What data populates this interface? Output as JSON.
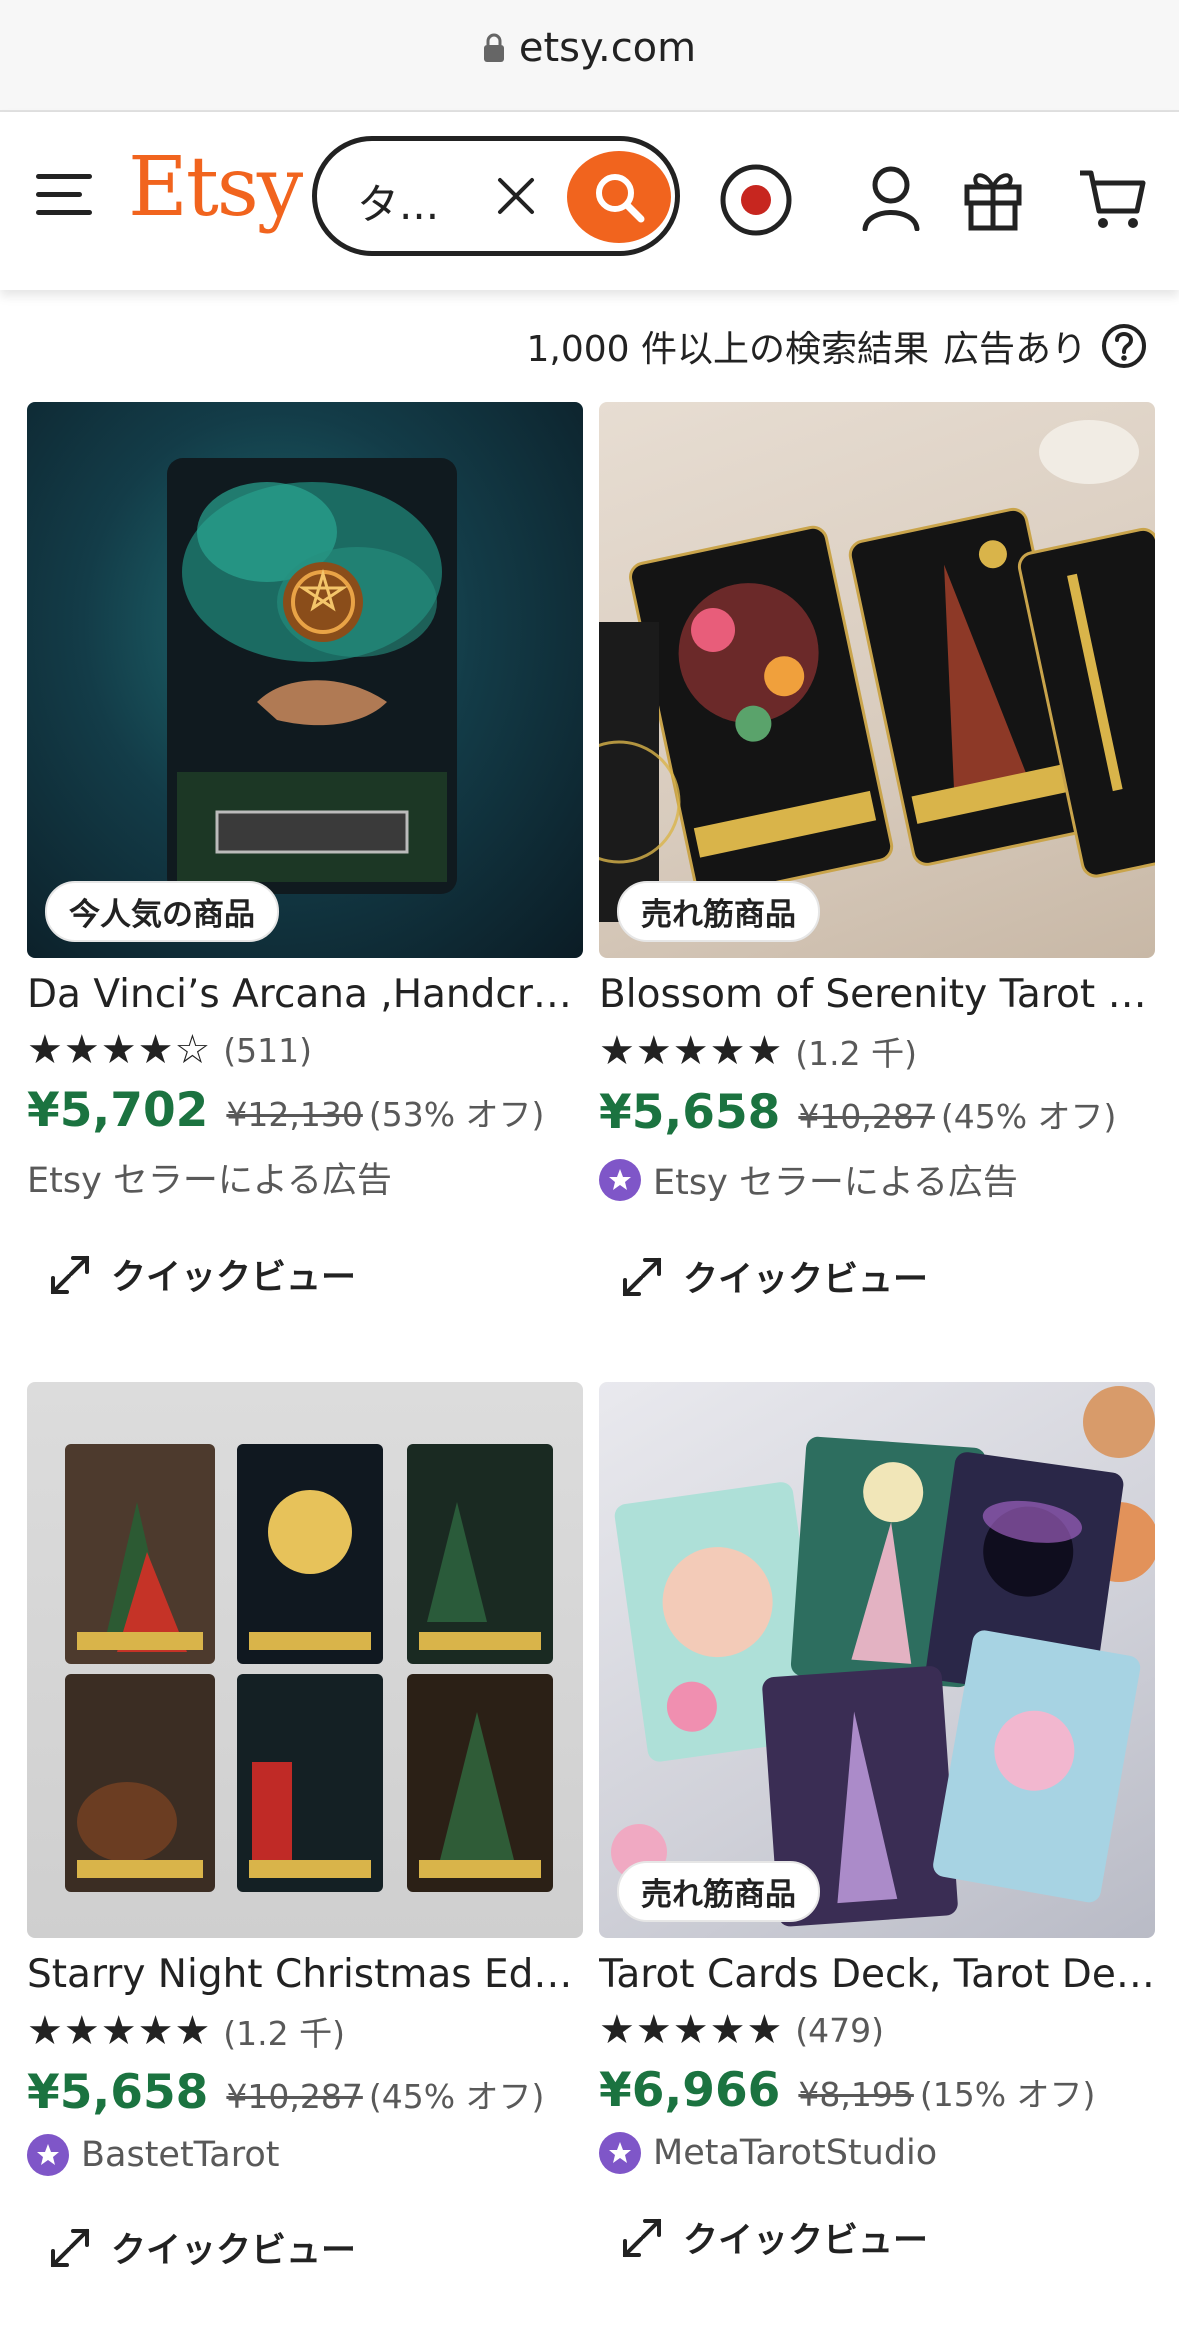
{
  "browser": {
    "url": "etsy.com"
  },
  "header": {
    "logo": "Etsy",
    "search_value": "タ...",
    "icons": [
      "menu-icon",
      "clear-icon",
      "search-icon",
      "record-icon",
      "account-icon",
      "gift-icon",
      "cart-icon"
    ]
  },
  "results": {
    "count_text": "1,000 件以上の検索結果",
    "ads_text": "広告あり"
  },
  "products": [
    {
      "badge": "今人気の商品",
      "title": "Da Vinci’s Arcana ,Handcrafted Tarot Deck",
      "stars": "★★★★☆",
      "rating_value": 4.5,
      "review_count": "(511)",
      "price": "¥5,702",
      "original_price": "¥12,130",
      "discount": "(53% オフ)",
      "seller": "Etsy セラーによる広告",
      "star_seller": false,
      "quick_view": "クイックビュー"
    },
    {
      "badge": "売れ筋商品",
      "title": "Blossom of Serenity Tarot Deck",
      "stars": "★★★★★",
      "rating_value": 5,
      "review_count": "(1.2 千)",
      "price": "¥5,658",
      "original_price": "¥10,287",
      "discount": "(45% オフ)",
      "seller": "Etsy セラーによる広告",
      "star_seller": true,
      "quick_view": "クイックビュー"
    },
    {
      "badge": "",
      "title": "Starry Night Christmas Edition Tarot",
      "stars": "★★★★★",
      "rating_value": 5,
      "review_count": "(1.2 千)",
      "price": "¥5,658",
      "original_price": "¥10,287",
      "discount": "(45% オフ)",
      "seller": "BastetTarot",
      "star_seller": true,
      "quick_view": "クイックビュー"
    },
    {
      "badge": "売れ筋商品",
      "title": "Tarot Cards Deck, Tarot Deck",
      "stars": "★★★★★",
      "rating_value": 5,
      "review_count": "(479)",
      "price": "¥6,966",
      "original_price": "¥8,195",
      "discount": "(15% オフ)",
      "seller": "MetaTarotStudio",
      "star_seller": true,
      "quick_view": "クイックビュー"
    }
  ],
  "colors": {
    "brand": "#f1641e",
    "price": "#1b7340",
    "star_seller": "#7f56c8"
  }
}
